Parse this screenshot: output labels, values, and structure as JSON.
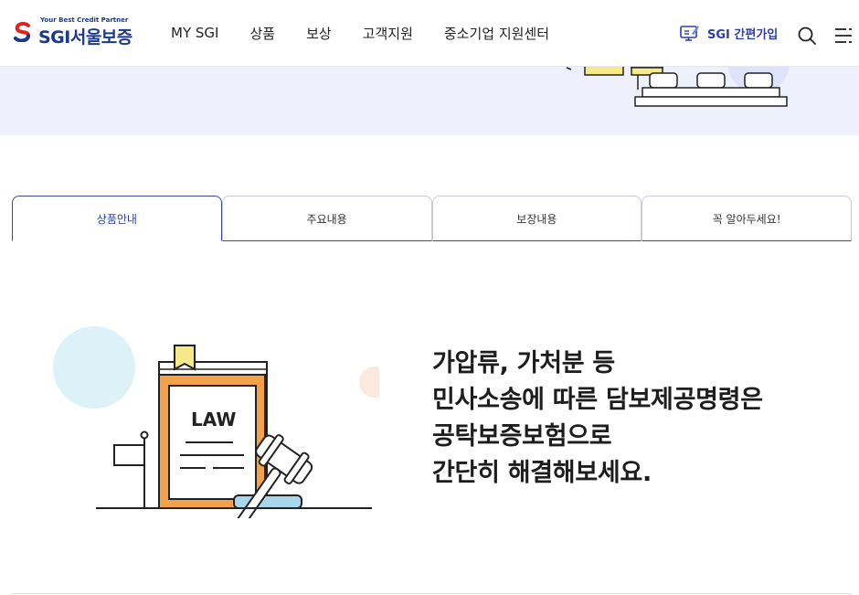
{
  "brand": {
    "tagline": "Your Best Credit Partner",
    "name": "SGI서울보증"
  },
  "nav": {
    "items": [
      "MY SGI",
      "상품",
      "보상",
      "고객지원",
      "중소기업 지원센터"
    ]
  },
  "header_actions": {
    "join_label": "SGI 간편가입",
    "search_icon": "search-icon",
    "menu_icon": "menu-icon"
  },
  "tabs": [
    {
      "label": "상품안내",
      "active": true
    },
    {
      "label": "주요내용",
      "active": false
    },
    {
      "label": "보장내용",
      "active": false
    },
    {
      "label": "꼭 알아두세요!",
      "active": false
    }
  ],
  "main": {
    "illustration_text": "LAW",
    "headline": [
      "가압류, 가처분 등",
      "민사소송에 따른 담보제공명령은",
      "공탁보증보험으로",
      "간단히 해결해보세요."
    ]
  },
  "colors": {
    "brand_blue": "#1b3a8c",
    "accent": "#2b3fa8",
    "tab_border": "#3b47a8",
    "banner_bg": "#eef0fb"
  }
}
